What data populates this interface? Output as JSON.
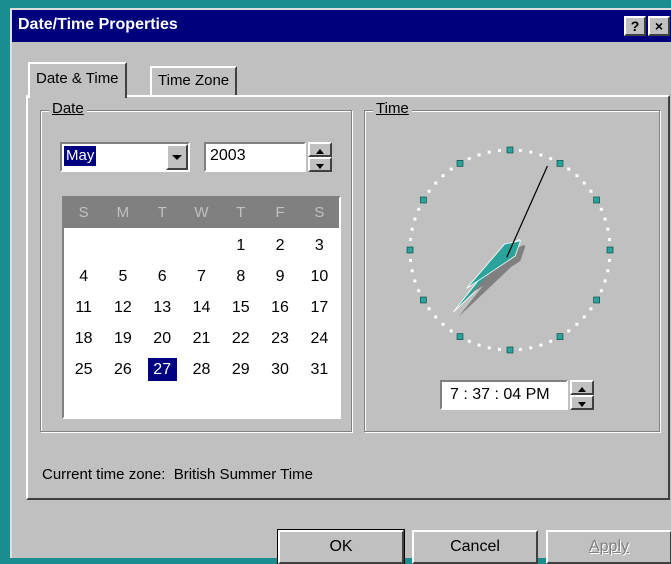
{
  "window": {
    "title": "Date/Time Properties",
    "help_button": "?",
    "close_button": "×"
  },
  "tabs": [
    {
      "label": "Date & Time",
      "active": true
    },
    {
      "label": "Time Zone",
      "active": false
    }
  ],
  "date_group": {
    "label": "Date",
    "month": "May",
    "year": "2003"
  },
  "calendar": {
    "weekdays": [
      "S",
      "M",
      "T",
      "W",
      "T",
      "F",
      "S"
    ],
    "days": [
      "",
      "",
      "",
      "",
      "1",
      "2",
      "3",
      "4",
      "5",
      "6",
      "7",
      "8",
      "9",
      "10",
      "11",
      "12",
      "13",
      "14",
      "15",
      "16",
      "17",
      "18",
      "19",
      "20",
      "21",
      "22",
      "23",
      "24",
      "25",
      "26",
      "27",
      "28",
      "29",
      "30",
      "31"
    ],
    "selected_day": "27"
  },
  "time_group": {
    "label": "Time",
    "time_value": "7 : 37 : 04 PM",
    "hour": 7,
    "minute": 37,
    "second": 4
  },
  "current_timezone": "Current time zone:  British Summer Time",
  "buttons": {
    "ok": "OK",
    "cancel": "Cancel",
    "apply": "Apply"
  },
  "colors": {
    "titlebar": "#00007c",
    "selection": "#000080",
    "hand": "#2aa39a",
    "desktop": "#1b8f8f"
  }
}
